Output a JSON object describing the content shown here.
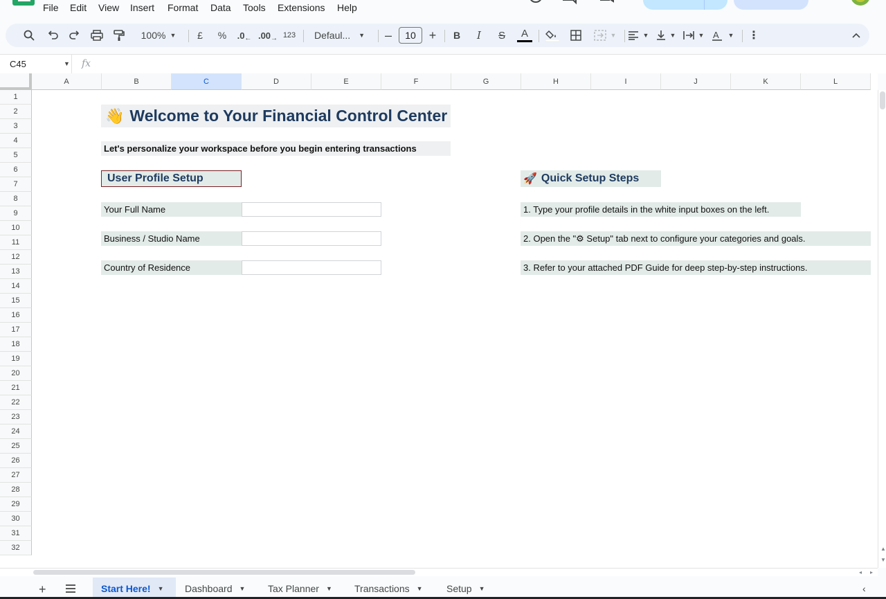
{
  "menu": {
    "items": [
      "File",
      "Edit",
      "View",
      "Insert",
      "Format",
      "Data",
      "Tools",
      "Extensions",
      "Help"
    ]
  },
  "toolbar": {
    "zoom": "100%",
    "currency": "£",
    "percent": "%",
    "decrease_decimals": ".0",
    "increase_decimals": ".00",
    "more_formats": "123",
    "font": "Defaul...",
    "font_size": "10",
    "bold": "B",
    "italic": "I",
    "strikethrough": "S",
    "text_color_letter": "A"
  },
  "formula_bar": {
    "cell_ref": "C45",
    "fx": "fx",
    "value": ""
  },
  "grid": {
    "columns": [
      "A",
      "B",
      "C",
      "D",
      "E",
      "F",
      "G",
      "H",
      "I",
      "J",
      "K",
      "L"
    ],
    "selected_column": "C",
    "rows": [
      "1",
      "2",
      "3",
      "4",
      "5",
      "6",
      "7",
      "8",
      "9",
      "10",
      "11",
      "12",
      "13",
      "14",
      "15",
      "16",
      "17",
      "18",
      "19",
      "20",
      "21",
      "22",
      "23",
      "24",
      "25",
      "26",
      "27",
      "28",
      "29",
      "30",
      "31",
      "32"
    ]
  },
  "content": {
    "title_emoji": "👋",
    "title": "Welcome to Your Financial Control Center",
    "subtitle": "Let's personalize your workspace before you begin entering transactions",
    "profile_header": "User Profile Setup",
    "fields": [
      {
        "label": "Your Full Name",
        "value": ""
      },
      {
        "label": "Business / Studio Name",
        "value": ""
      },
      {
        "label": "Country of Residence",
        "value": ""
      }
    ],
    "quick_setup_emoji": "🚀",
    "quick_setup_header": "Quick Setup Steps",
    "steps": [
      "1. Type your profile details in the white input boxes on the left.",
      "2. Open the \"⚙ Setup\" tab next to configure your categories and goals.",
      "3. Refer to your attached PDF Guide for deep step-by-step instructions."
    ]
  },
  "sheets": {
    "tabs": [
      "Start Here!",
      "Dashboard",
      "Tax Planner",
      "Transactions",
      "Setup"
    ],
    "active": "Start Here!"
  },
  "colors": {
    "title_text": "#1e3a5f",
    "label_fill": "#e2ebe8",
    "header_border": "#7a1f24",
    "active_tab": "#0b57d0",
    "selected_col": "#d3e3fd"
  }
}
